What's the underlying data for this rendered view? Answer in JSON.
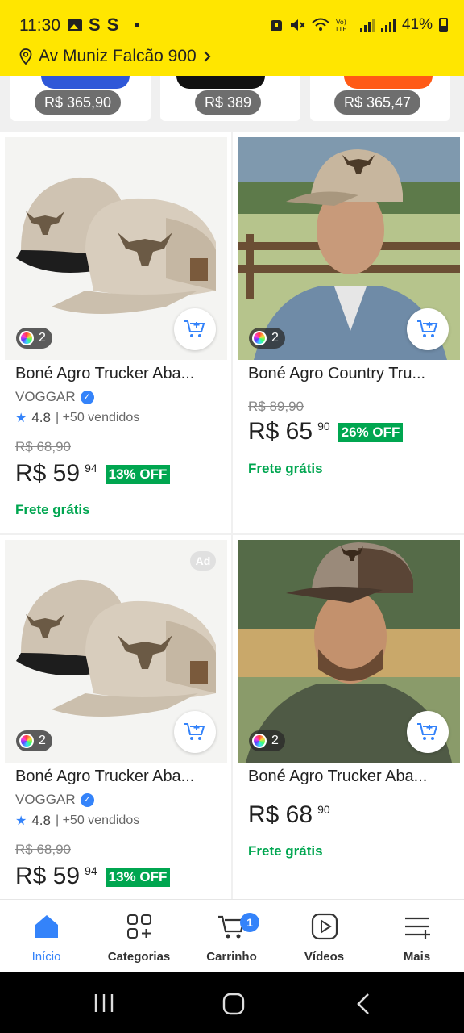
{
  "status": {
    "time": "11:30",
    "battery": "41%",
    "s1": "S",
    "s2": "S"
  },
  "address": {
    "label": "Av Muniz Falcão 900"
  },
  "top_strip": {
    "prices": [
      "R$ 365,90",
      "R$ 389",
      "R$ 365,47"
    ]
  },
  "products": [
    {
      "title": "Boné Agro Trucker Aba...",
      "seller": "VOGGAR",
      "rating": "4.8",
      "sold": "| +50 vendidos",
      "variants": "2",
      "old_price": "R$ 68,90",
      "price": "R$ 59",
      "cents": "94",
      "off": "13% OFF",
      "shipping": "Frete grátis"
    },
    {
      "title": "Boné Agro Country Tru...",
      "variants": "2",
      "old_price": "R$ 89,90",
      "price": "R$ 65",
      "cents": "90",
      "off": "26% OFF",
      "shipping": "Frete grátis"
    },
    {
      "title": "Boné Agro Trucker Aba...",
      "seller": "VOGGAR",
      "rating": "4.8",
      "sold": "| +50 vendidos",
      "variants": "2",
      "ad": "Ad",
      "old_price": "R$ 68,90",
      "price": "R$ 59",
      "cents": "94",
      "off": "13% OFF"
    },
    {
      "title": "Boné Agro Trucker Aba...",
      "variants": "2",
      "price": "R$ 68",
      "cents": "90",
      "shipping": "Frete grátis"
    }
  ],
  "bottom_nav": {
    "items": [
      "Início",
      "Categorias",
      "Carrinho",
      "Vídeos",
      "Mais"
    ],
    "cart_count": "1"
  },
  "colors": {
    "brand_yellow": "#ffe600",
    "accent_blue": "#3483fa",
    "green": "#00a650"
  }
}
